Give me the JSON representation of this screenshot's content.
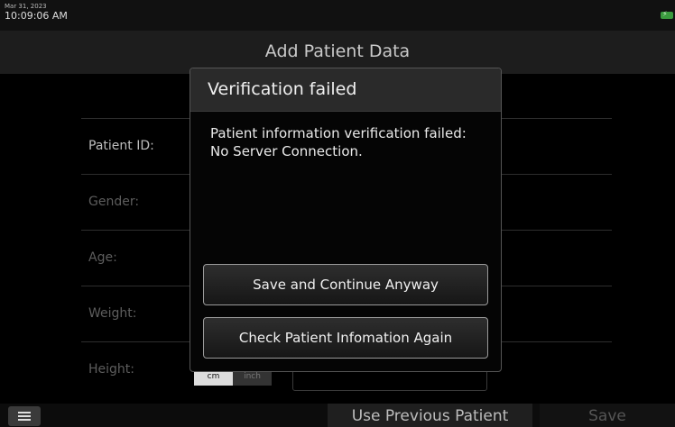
{
  "status_bar": {
    "date": "Mar 31, 2023",
    "time": "10:09:06 AM",
    "battery_icon": "battery-charging-icon",
    "battery_color": "#3a9a3e"
  },
  "header": {
    "title": "Add Patient Data"
  },
  "form": {
    "fields": [
      {
        "label": "Patient ID:"
      },
      {
        "label": "Gender:"
      },
      {
        "label": "Age:"
      },
      {
        "label": "Weight:"
      },
      {
        "label": "Height:"
      }
    ],
    "height_units": {
      "cm": "cm",
      "in": "inch"
    }
  },
  "dialog": {
    "title": "Verification failed",
    "message": "Patient information verification failed: No Server Connection.",
    "buttons": {
      "save_continue": "Save and Continue Anyway",
      "check_again": "Check Patient Infomation Again"
    }
  },
  "bottom_bar": {
    "menu_icon": "hamburger-menu-icon",
    "use_previous": "Use Previous Patient",
    "save": "Save"
  }
}
